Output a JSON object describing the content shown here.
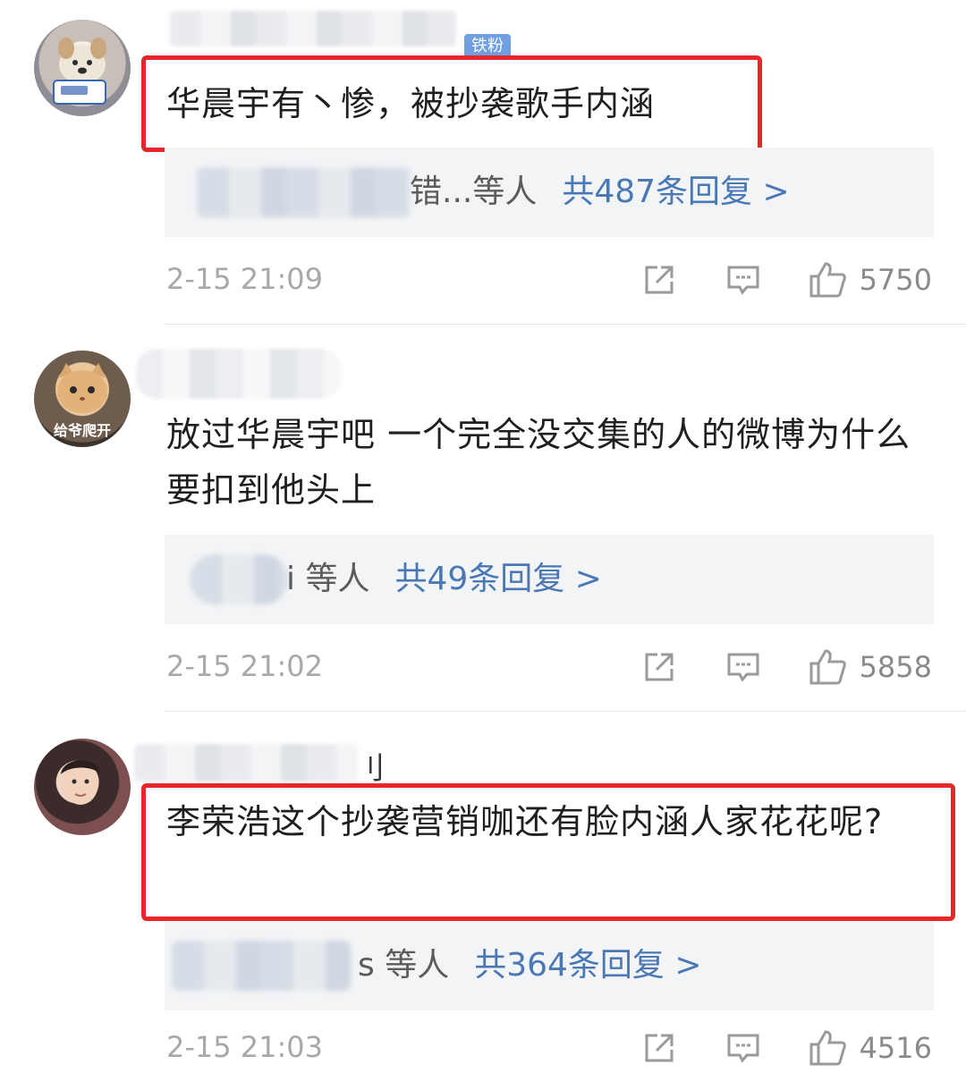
{
  "comments": [
    {
      "badge": "铁粉",
      "name_tail": "",
      "text": "华晨宇有丶惨，被抄袭歌手内涵",
      "reply_suffix": "错...等人",
      "reply_count": "共487条回复 >",
      "time": "2-15 21:09",
      "likes": "5750"
    },
    {
      "avatar_caption": "给爷爬开",
      "name_tail": "",
      "text": "放过华晨宇吧 一个完全没交集的人的微博为什么要扣到他头上",
      "reply_suffix": "i 等人",
      "reply_count": "共49条回复 >",
      "time": "2-15 21:02",
      "likes": "5858"
    },
    {
      "name_tail": "刂",
      "text": "李荣浩这个抄袭营销咖还有脸内涵人家花花呢?",
      "reply_suffix": "s 等人",
      "reply_count": "共364条回复 >",
      "time": "2-15 21:03",
      "likes": "4516"
    }
  ],
  "icons": {
    "share": "share-icon",
    "reply": "comment-icon",
    "like": "thumbs-up-icon"
  },
  "colors": {
    "highlight_border": "#e8262a",
    "reply_link": "#4a78b5",
    "badge_bg": "#6f9fe0"
  }
}
